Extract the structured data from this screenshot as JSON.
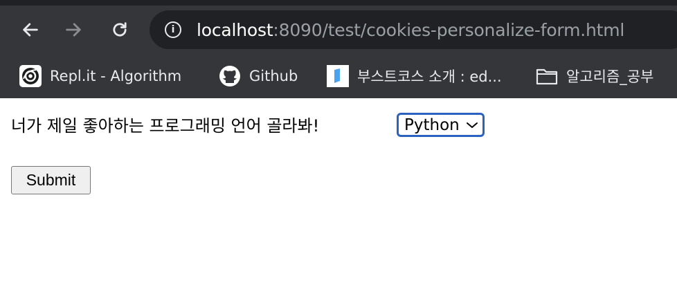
{
  "browser": {
    "url_host": "localhost",
    "url_path": ":8090/test/cookies-personalize-form.html",
    "bookmarks": [
      {
        "label": "Repl.it - Algorithm",
        "icon": "replit-icon"
      },
      {
        "label": "Github",
        "icon": "github-icon"
      },
      {
        "label": "부스트코스 소개 : ed...",
        "icon": "boostcourse-icon"
      },
      {
        "label": "알고리즘_공부",
        "icon": "folder-icon"
      }
    ]
  },
  "form": {
    "question": "너가 제일 좋아하는 프로그래밍 언어 골라봐!",
    "select_value": "Python",
    "submit_label": "Submit"
  },
  "colors": {
    "chrome_bg": "#35363a",
    "omnibox_bg": "#202124",
    "focus_ring": "#2b61bf"
  }
}
